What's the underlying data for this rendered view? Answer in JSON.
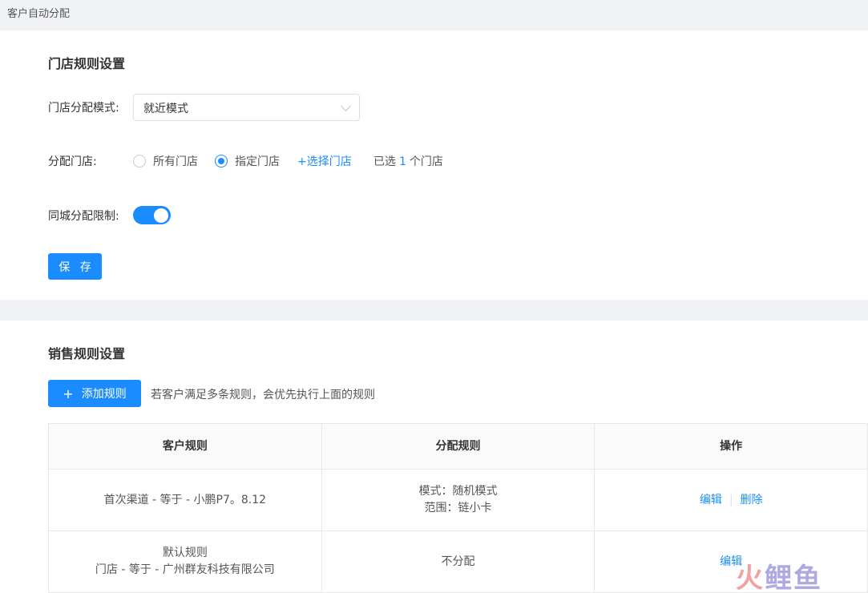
{
  "page": {
    "title": "客户自动分配"
  },
  "store_rules": {
    "title": "门店规则设置",
    "mode_label": "门店分配模式:",
    "mode_value": "就近模式",
    "assign_label": "分配门店:",
    "option_all": "所有门店",
    "option_specified": "指定门店",
    "selected_option": "指定门店",
    "select_link": "+选择门店",
    "selected_prefix": "已选",
    "selected_count": "1",
    "selected_suffix": "个门店",
    "same_city_label": "同城分配限制:",
    "same_city_enabled": true,
    "save_label": "保 存"
  },
  "sales_rules": {
    "title": "销售规则设置",
    "add_label": "添加规则",
    "hint": "若客户满足多条规则，会优先执行上面的规则",
    "columns": [
      "客户规则",
      "分配规则",
      "操作"
    ],
    "rows": [
      {
        "customer_rule": [
          "首次渠道 - 等于 - 小鹏P7。8.12"
        ],
        "assign_rule": [
          "模式：随机模式",
          "范围：链小卡"
        ],
        "actions": [
          "编辑",
          "删除"
        ]
      },
      {
        "customer_rule": [
          "默认规则",
          "门店 - 等于 - 广州群友科技有限公司"
        ],
        "assign_rule": [
          "不分配"
        ],
        "actions": [
          "编辑"
        ]
      }
    ]
  },
  "watermark": {
    "fire": "火",
    "rest": "鲤鱼"
  },
  "colors": {
    "accent": "#1a8cff",
    "background": "#f0f2f5"
  }
}
